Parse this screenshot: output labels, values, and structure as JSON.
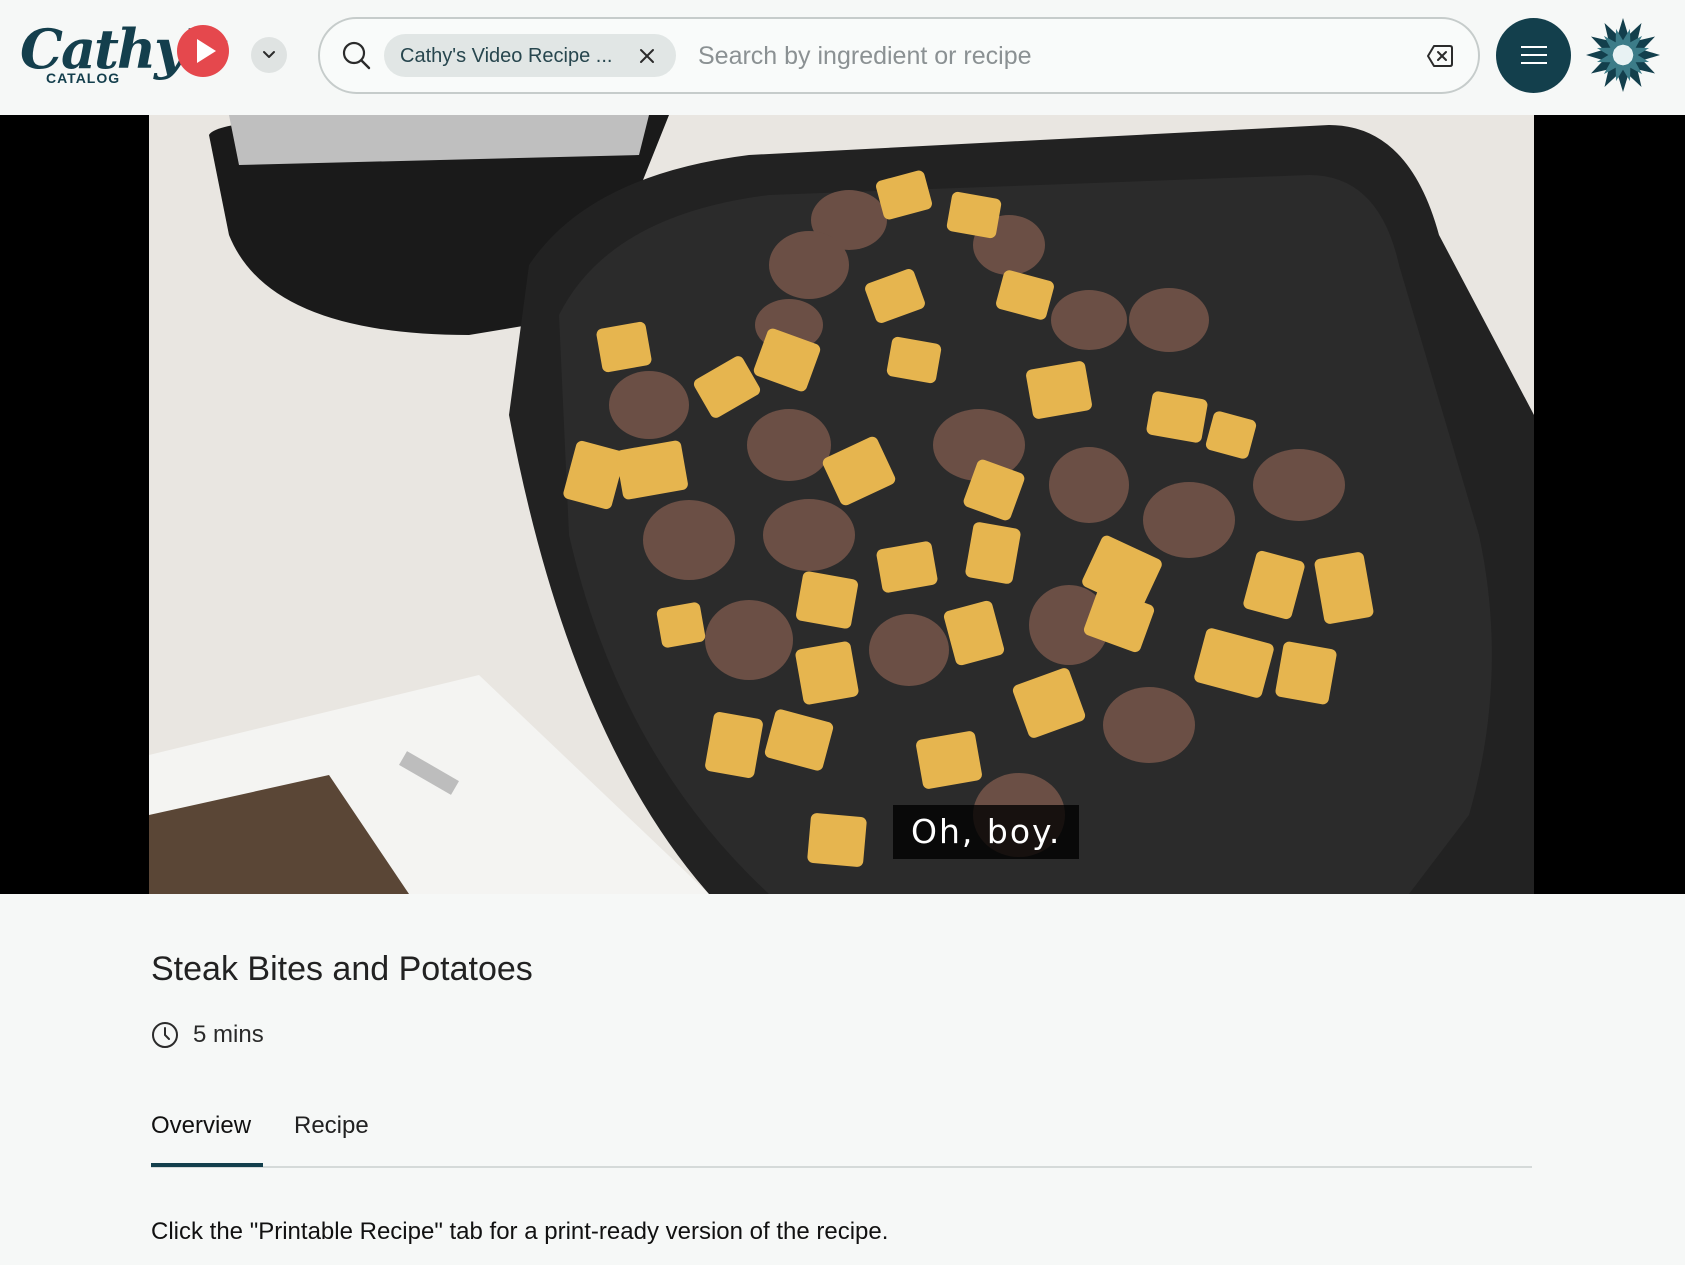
{
  "brand": {
    "logo_script": "Cathy's",
    "logo_sub": "CATALOG"
  },
  "search": {
    "chip_label": "Cathy's Video Recipe ...",
    "placeholder": "Search by ingredient or recipe",
    "value": ""
  },
  "video": {
    "caption": "Oh, boy."
  },
  "recipe": {
    "title": "Steak Bites and Potatoes",
    "time": "5 mins"
  },
  "tabs": [
    {
      "label": "Overview",
      "active": true
    },
    {
      "label": "Recipe",
      "active": false
    }
  ],
  "overview": {
    "note": "Click the \"Printable Recipe\" tab for a print-ready version of the recipe."
  },
  "colors": {
    "brand_teal": "#133f4c",
    "play_red": "#e5484d",
    "background": "#f6f8f7"
  },
  "icons": {
    "search": "search-icon",
    "chip_close": "close-icon",
    "clear": "clear-input-icon",
    "menu": "hamburger-menu-icon",
    "dropdown": "chevron-down-icon",
    "time": "clock-icon"
  }
}
